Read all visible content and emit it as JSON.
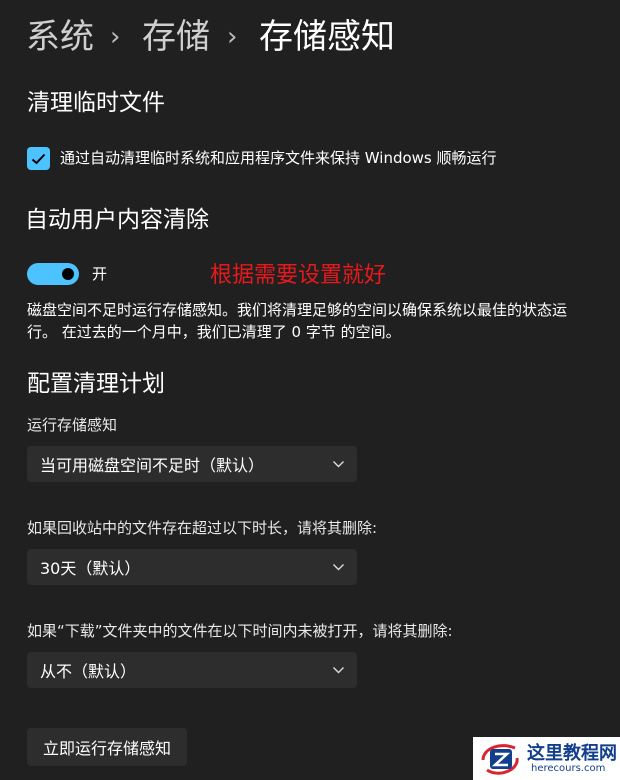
{
  "breadcrumb": {
    "items": [
      "系统",
      "存储",
      "存储感知"
    ],
    "separator": "›"
  },
  "cleanup_temp": {
    "title": "清理临时文件",
    "checkbox_label": "通过自动清理临时系统和应用程序文件来保持 Windows 顺畅运行",
    "checked": true
  },
  "auto_cleanup": {
    "title": "自动用户内容清除",
    "toggle_label": "开",
    "toggle_on": true,
    "description": "磁盘空间不足时运行存储感知。我们将清理足够的空间以确保系统以最佳的状态运行。 在过去的一个月中，我们已清理了 0 字节 的空间。"
  },
  "annotation": {
    "text": "根据需要设置就好",
    "color": "#e8191c"
  },
  "schedule": {
    "title": "配置清理计划",
    "run_label": "运行存储感知",
    "run_value": "当可用磁盘空间不足时（默认）",
    "recycle_label": "如果回收站中的文件存在超过以下时长，请将其删除:",
    "recycle_value": "30天（默认）",
    "downloads_label": "如果“下载”文件夹中的文件在以下时间内未被打开，请将其删除:",
    "downloads_value": "从不（默认）"
  },
  "run_now_button": "立即运行存储感知",
  "watermark": {
    "title": "这里教程网",
    "url": "herecours.com"
  },
  "colors": {
    "background": "#202020",
    "accent": "#4cc2ff",
    "control_bg": "#2d2d2d"
  }
}
